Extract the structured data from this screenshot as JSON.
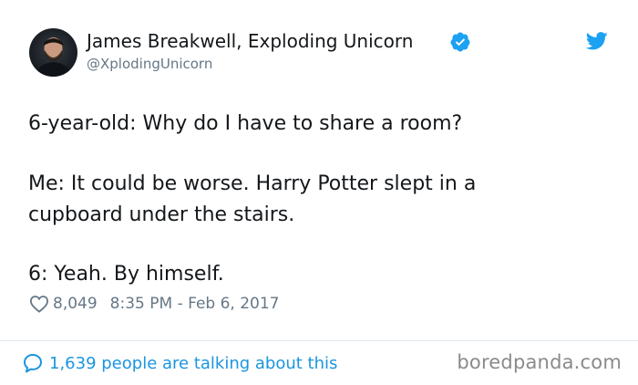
{
  "author": {
    "name": "James Breakwell, Exploding Unicorn",
    "handle": "@XplodingUnicorn"
  },
  "tweet": {
    "lines": [
      "6-year-old: Why do I have to share a room?",
      "Me: It could be worse. Harry Potter slept in a",
      "cupboard under the stairs.",
      "6: Yeah. By himself."
    ]
  },
  "meta": {
    "likes": "8,049",
    "timestamp": "8:35 PM - Feb 6, 2017"
  },
  "footer": {
    "talking": "1,639 people are talking about this"
  },
  "watermark": "boredpanda.com",
  "colors": {
    "accent": "#1da1f2",
    "link": "#1b95e0",
    "muted": "#657786",
    "text": "#14171a"
  },
  "icons": [
    "avatar",
    "verified-badge-icon",
    "twitter-bird-icon",
    "heart-icon",
    "speech-bubble-icon"
  ]
}
